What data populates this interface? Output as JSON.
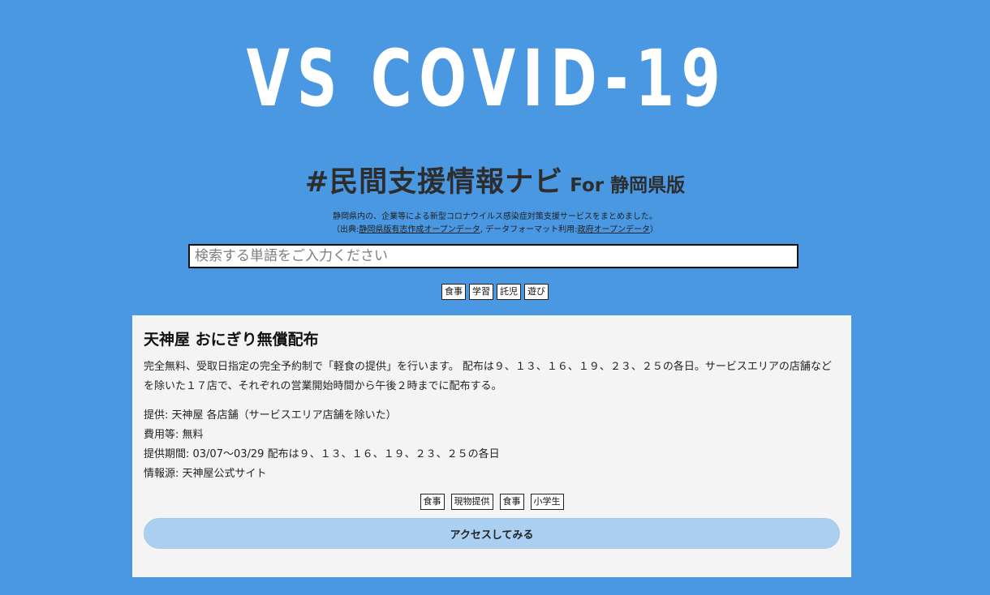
{
  "header": {
    "logo_text": "VS COVID-19",
    "title": "#民間支援情報ナビ",
    "title_for": "For 静岡県版",
    "description_line1": "静岡県内の、企業等による新型コロナウイルス感染症対策支援サービスをまとめました。",
    "source_prefix": "（出典:",
    "source_link1": "静岡県版有志作成オープンデータ",
    "source_middle": ", データフォーマット利用:",
    "source_link2": "政府オープンデータ",
    "source_suffix": "）"
  },
  "search": {
    "placeholder": "検索する単語をご入力ください",
    "value": ""
  },
  "filter_tags": [
    "食事",
    "学習",
    "託児",
    "遊び"
  ],
  "card": {
    "title": "天神屋 おにぎり無償配布",
    "description": "完全無料、受取日指定の完全予約制で「軽食の提供」を行います。 配布は９、１３、１６、１９、２３、２５の各日。サービスエリアの店舗などを除いた１７店で、それぞれの営業開始時間から午後２時までに配布する。",
    "provider": "提供: 天神屋 各店舗（サービスエリア店舗を除いた）",
    "cost": "費用等: 無料",
    "period": "提供期間: 03/07〜03/29 配布は９、１３、１６、１９、２３、２５の各日",
    "source": "情報源: 天神屋公式サイト",
    "tags": [
      "食事",
      "現物提供",
      "食事",
      "小学生"
    ],
    "button_label": "アクセスしてみる"
  },
  "colors": {
    "background": "#4a98e2",
    "card_background": "#f4f4f4",
    "button_background": "#aacff1",
    "title_text": "#2d2d2d"
  }
}
